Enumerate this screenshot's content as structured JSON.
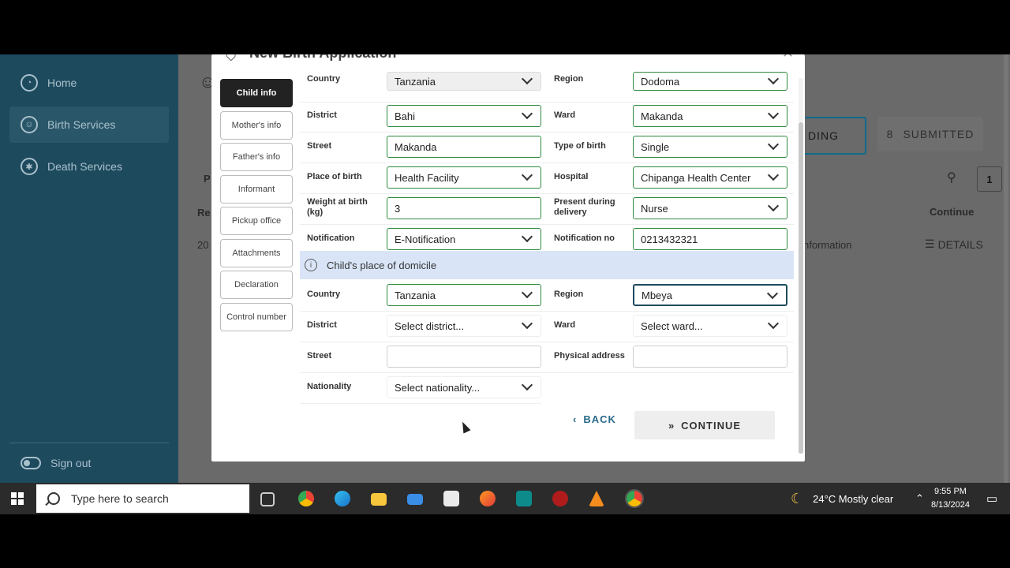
{
  "sidebar": {
    "items": [
      {
        "label": "Home",
        "icon": "dashboard-icon"
      },
      {
        "label": "Birth Services",
        "icon": "smile-icon"
      },
      {
        "label": "Death Services",
        "icon": "gear-icon"
      }
    ],
    "signout": "Sign out"
  },
  "background": {
    "tab_pending": "DING",
    "tab_submitted_count": "8",
    "tab_submitted": "SUBMITTED",
    "col_continue": "Continue",
    "row_info": "nformation",
    "details_label": "DETAILS",
    "page_number": "1",
    "frag_p": "P",
    "frag_re": "Re",
    "frag_20": "20"
  },
  "modal": {
    "title": "New Birth Application",
    "tabs": [
      "Child info",
      "Mother's info",
      "Father's info",
      "Informant",
      "Pickup office",
      "Attachments",
      "Declaration",
      "Control number"
    ],
    "birth": {
      "country_label": "Country",
      "country_value": "Tanzania",
      "region_label": "Region",
      "region_value": "Dodoma",
      "district_label": "District",
      "district_value": "Bahi",
      "ward_label": "Ward",
      "ward_value": "Makanda",
      "street_label": "Street",
      "street_value": "Makanda",
      "type_label": "Type of birth",
      "type_value": "Single",
      "place_label": "Place of birth",
      "place_value": "Health Facility",
      "hospital_label": "Hospital",
      "hospital_value": "Chipanga Health Center",
      "weight_label": "Weight at birth (kg)",
      "weight_value": "3",
      "present_label": "Present during delivery",
      "present_value": "Nurse",
      "notification_label": "Notification",
      "notification_value": "E-Notification",
      "notification_no_label": "Notification no",
      "notification_no_value": "0213432321"
    },
    "domicile_banner": "Child's place of domicile",
    "domicile": {
      "country_label": "Country",
      "country_value": "Tanzania",
      "region_label": "Region",
      "region_value": "Mbeya",
      "district_label": "District",
      "district_value": "Select district...",
      "ward_label": "Ward",
      "ward_value": "Select ward...",
      "street_label": "Street",
      "street_value": "",
      "physical_label": "Physical address",
      "physical_value": "",
      "nationality_label": "Nationality",
      "nationality_value": "Select nationality..."
    },
    "back": "BACK",
    "continue": "CONTINUE"
  },
  "taskbar": {
    "search_placeholder": "Type here to search",
    "weather": "24°C  Mostly clear",
    "time": "9:55 PM",
    "date": "8/13/2024"
  }
}
